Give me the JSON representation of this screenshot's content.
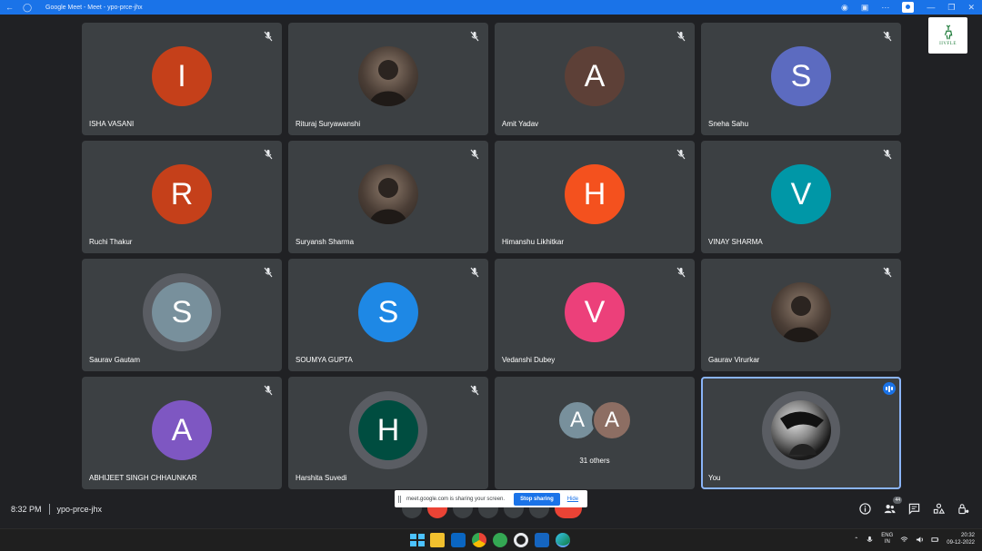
{
  "browser": {
    "window_title": "Google Meet - Meet - ypo-prce-jhx"
  },
  "participants": [
    {
      "name": "ISHA VASANI",
      "initial": "I",
      "color": "#c5401a",
      "type": "letter"
    },
    {
      "name": "Rituraj Suryawanshi",
      "initial": "",
      "color": "#6b5a4a",
      "type": "photo"
    },
    {
      "name": "Amit Yadav",
      "initial": "A",
      "color": "#5d4037",
      "type": "letter"
    },
    {
      "name": "Sneha Sahu",
      "initial": "S",
      "color": "#5c6bc0",
      "type": "letter"
    },
    {
      "name": "Ruchi Thakur",
      "initial": "R",
      "color": "#c5401a",
      "type": "letter"
    },
    {
      "name": "Suryansh Sharma",
      "initial": "",
      "color": "#7a8a99",
      "type": "photo"
    },
    {
      "name": "Himanshu Likhitkar",
      "initial": "H",
      "color": "#f4511e",
      "type": "letter"
    },
    {
      "name": "VINAY SHARMA",
      "initial": "V",
      "color": "#0097a7",
      "type": "letter"
    },
    {
      "name": "Saurav Gautam",
      "initial": "S",
      "color": "#78909c",
      "type": "letter-ring"
    },
    {
      "name": "SOUMYA GUPTA",
      "initial": "S",
      "color": "#1e88e5",
      "type": "letter"
    },
    {
      "name": "Vedanshi Dubey",
      "initial": "V",
      "color": "#ec407a",
      "type": "letter"
    },
    {
      "name": "Gaurav Virurkar",
      "initial": "",
      "color": "#a08a70",
      "type": "photo"
    },
    {
      "name": "ABHIJEET SINGH CHHAUNKAR",
      "initial": "A",
      "color": "#7e57c2",
      "type": "letter"
    },
    {
      "name": "Harshita Suvedi",
      "initial": "H",
      "color": "#004d40",
      "type": "letter-ring"
    }
  ],
  "others_tile": {
    "label": "31 others",
    "avatars": [
      {
        "initial": "A",
        "color": "#78909c"
      },
      {
        "initial": "A",
        "color": "#8d6e63"
      }
    ]
  },
  "you_tile": {
    "name": "You"
  },
  "logo": {
    "text": "IIVFLE"
  },
  "meeting": {
    "time": "8:32 PM",
    "code": "ypo-prce-jhx"
  },
  "share_bar": {
    "message": "meet.google.com is sharing your screen.",
    "stop_label": "Stop sharing",
    "hide_label": "Hide"
  },
  "people_count": "44",
  "taskbar": {
    "lang_top": "ENG",
    "lang_bottom": "IN",
    "clock_time": "20:32",
    "clock_date": "09-12-2022"
  },
  "colors": {
    "tile_bg": "#3c4043",
    "page_bg": "#202124",
    "accent": "#1a73e8",
    "danger": "#ea4335"
  }
}
